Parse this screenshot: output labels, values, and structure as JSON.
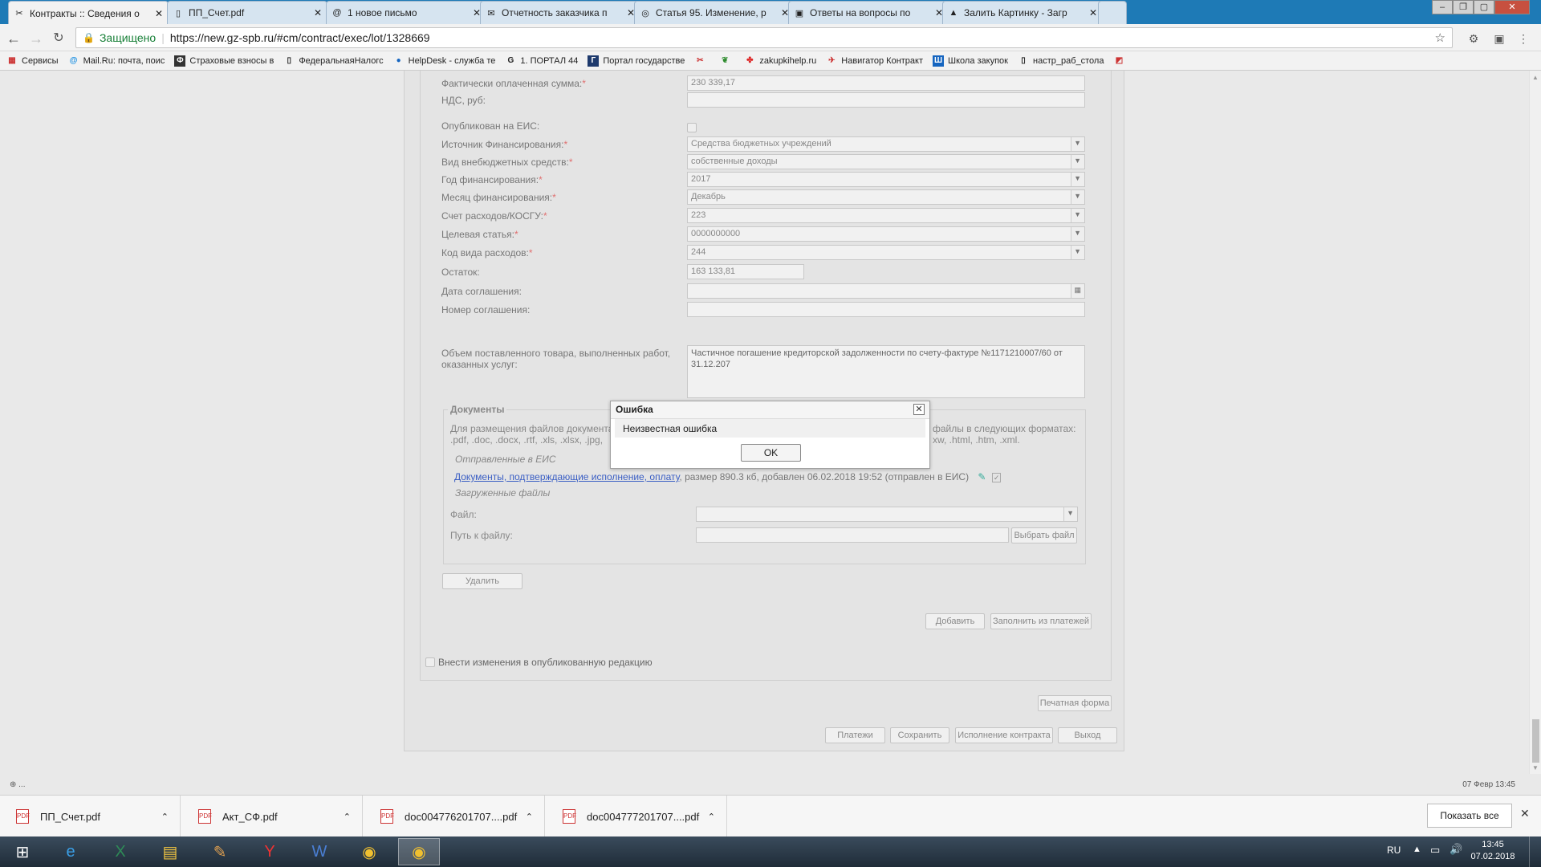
{
  "browser": {
    "tabs": [
      {
        "title": "Контракты :: Сведения о",
        "icon": "✂",
        "active": true
      },
      {
        "title": "ПП_Счет.pdf",
        "icon": "▯"
      },
      {
        "title": "1 новое письмо",
        "icon": "@"
      },
      {
        "title": "Отчетность заказчика п",
        "icon": "✉"
      },
      {
        "title": "Статья 95. Изменение, р",
        "icon": "◎"
      },
      {
        "title": "Ответы на вопросы по",
        "icon": "▣"
      },
      {
        "title": "Залить Картинку - Загр",
        "icon": "▲"
      }
    ],
    "secure_label": "Защищено",
    "url": "https://new.gz-spb.ru/#cm/contract/exec/lot/1328669",
    "bookmarks": [
      {
        "label": "Сервисы",
        "icon": "▦"
      },
      {
        "label": "Mail.Ru: почта, поис",
        "icon": "@"
      },
      {
        "label": "Страховые взносы в",
        "icon": "Ф"
      },
      {
        "label": "ФедеральнаяНалогс",
        "icon": "▯"
      },
      {
        "label": "HelpDesk - служба те",
        "icon": "●"
      },
      {
        "label": "1. ПОРТАЛ 44",
        "icon": "G"
      },
      {
        "label": "Портал государстве",
        "icon": "Г"
      },
      {
        "label": "",
        "icon": "✂"
      },
      {
        "label": "",
        "icon": "❦"
      },
      {
        "label": "zakupkihelp.ru",
        "icon": "✤"
      },
      {
        "label": "Навигатор Контракт",
        "icon": "✈"
      },
      {
        "label": "Школа закупок",
        "icon": "Ш"
      },
      {
        "label": "настр_раб_стола",
        "icon": "▯"
      },
      {
        "label": "",
        "icon": "◩"
      }
    ]
  },
  "form": {
    "fields": [
      {
        "label": "Фактически оплаченная сумма:",
        "required": true,
        "value": "230 339,17",
        "type": "text"
      },
      {
        "label": "НДС, руб:",
        "required": false,
        "value": "",
        "type": "text"
      },
      {
        "label": "Опубликован на ЕИС:",
        "required": false,
        "value": "",
        "type": "checkbox"
      },
      {
        "label": "Источник Финансирования:",
        "required": true,
        "value": "Средства бюджетных учреждений",
        "type": "select"
      },
      {
        "label": "Вид внебюджетных средств:",
        "required": true,
        "value": "собственные доходы",
        "type": "select"
      },
      {
        "label": "Год финансирования:",
        "required": true,
        "value": "2017",
        "type": "select"
      },
      {
        "label": "Месяц финансирования:",
        "required": true,
        "value": "Декабрь",
        "type": "select"
      },
      {
        "label": "Счет расходов/КОСГУ:",
        "required": true,
        "value": "223",
        "type": "select"
      },
      {
        "label": "Целевая статья:",
        "required": true,
        "value": "0000000000",
        "type": "select"
      },
      {
        "label": "Код вида расходов:",
        "required": true,
        "value": "244",
        "type": "select"
      },
      {
        "label": "Остаток:",
        "required": false,
        "value": "163 133,81",
        "type": "short"
      },
      {
        "label": "Дата соглашения:",
        "required": false,
        "value": "",
        "type": "date"
      },
      {
        "label": "Номер соглашения:",
        "required": false,
        "value": "",
        "type": "text"
      }
    ],
    "volume_label": "Объем поставленного товара, выполненных работ, оказанных услуг:",
    "volume_value": "Частичное погашение кредиторской задолженности по счету-фактуре №1171210007/60 от 31.12.207",
    "documents": {
      "legend": "Документы",
      "hint_left": "Для размещения файлов документа",
      "hint_left2": ".pdf, .doc, .docx, .rtf, .xls, .xlsx, .jpg,",
      "hint_right": "файлы в следующих форматах:",
      "hint_right2": "xw, .html, .htm, .xml.",
      "sent_label": "Отправленные в ЕИС",
      "doc_link": "Документы, подтверждающие исполнение, оплату",
      "doc_info": ", размер 890.3 кб, добавлен 06.02.2018 19:52 (отправлен в ЕИС)",
      "uploaded_label": "Загруженные файлы",
      "file_label": "Файл:",
      "path_label": "Путь к файлу:",
      "choose_file": "Выбрать файл"
    },
    "delete_button": "Удалить",
    "add_button": "Добавить",
    "fill_from_payments": "Заполнить из платежей",
    "publish_changes": "Внести изменения в опубликованную редакцию",
    "print_form": "Печатная форма",
    "bottom_buttons": [
      "Платежи",
      "Сохранить",
      "Исполнение контракта",
      "Выход"
    ]
  },
  "dialog": {
    "title": "Ошибка",
    "message": "Неизвестная ошибка",
    "ok": "OK"
  },
  "status": {
    "left": "⊕ ...",
    "right": "07 Февр 13:45"
  },
  "downloads": {
    "items": [
      "ПП_Счет.pdf",
      "Акт_СФ.pdf",
      "doc004776201707....pdf",
      "doc004777201707....pdf"
    ],
    "show_all": "Показать все"
  },
  "taskbar": {
    "lang": "RU",
    "time": "13:45",
    "date": "07.02.2018"
  },
  "colors": {
    "tabbar": "#1e7ab6",
    "secure": "#188038",
    "link": "#3b5fc4",
    "required": "#e07070"
  }
}
